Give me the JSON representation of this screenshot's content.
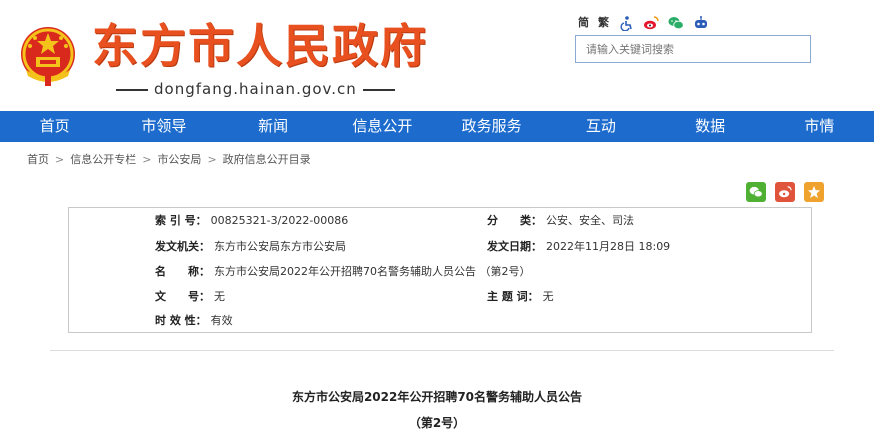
{
  "header": {
    "site_title": "东方市人民政府",
    "domain": "dongfang.hainan.gov.cn",
    "tools": {
      "simplified": "简",
      "traditional": "繁",
      "icons": [
        "accessibility-icon",
        "weibo-icon",
        "wechat-icon",
        "robot-icon"
      ]
    },
    "search": {
      "placeholder": "请输入关键词搜索"
    }
  },
  "nav": {
    "items": [
      {
        "label": "首页"
      },
      {
        "label": "市领导"
      },
      {
        "label": "新闻"
      },
      {
        "label": "信息公开"
      },
      {
        "label": "政务服务"
      },
      {
        "label": "互动"
      },
      {
        "label": "数据"
      },
      {
        "label": "市情"
      }
    ],
    "color": "#1d6ccd"
  },
  "breadcrumb": {
    "items": [
      "首页",
      "信息公开专栏",
      "市公安局",
      "政府信息公开目录"
    ],
    "separator": ">"
  },
  "share": {
    "icons": [
      "wechat-share-icon",
      "weibo-share-icon",
      "favorite-icon"
    ]
  },
  "info": {
    "index_label": "索 引 号：",
    "index_value": "00825321-3/2022-00086",
    "category_label": "分　　类：",
    "category_value": "公安、安全、司法",
    "issuer_label": "发文机关：",
    "issuer_value": "东方市公安局东方市公安局",
    "date_label": "发文日期：",
    "date_value": "2022年11月28日 18:09",
    "name_label": "名　　称：",
    "name_value": "东方市公安局2022年公开招聘70名警务辅助人员公告 （第2号）",
    "docno_label": "文　　号：",
    "docno_value": "无",
    "subject_label": "主 题 词：",
    "subject_value": "无",
    "validity_label": "时 效 性：",
    "validity_value": "有效"
  },
  "article": {
    "title": "东方市公安局2022年公开招聘70名警务辅助人员公告",
    "subtitle": "（第2号）"
  },
  "colors": {
    "brand": "#e8511f",
    "nav": "#1d6ccd",
    "wechat": "#50b034",
    "weibo": "#e0543b",
    "favorite": "#f0a22e"
  }
}
